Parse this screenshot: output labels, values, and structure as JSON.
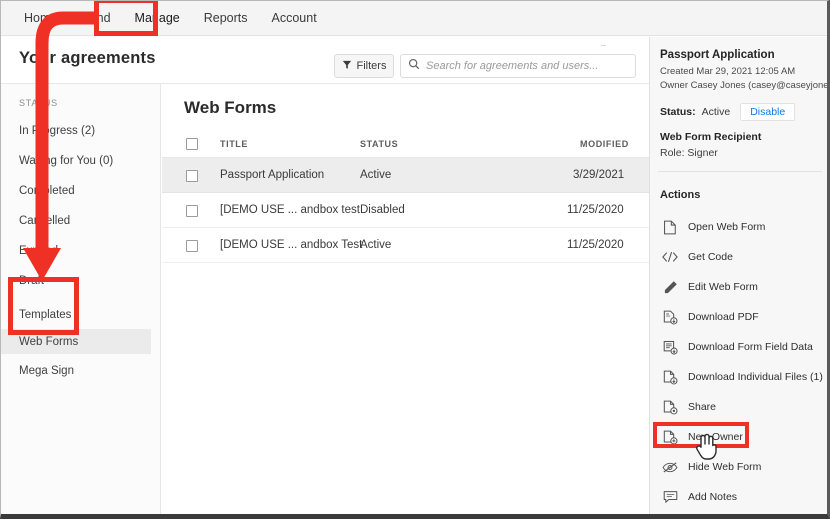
{
  "nav": {
    "tabs": [
      {
        "label": "Home",
        "active": false
      },
      {
        "label": "Send",
        "active": false
      },
      {
        "label": "Manage",
        "active": true
      },
      {
        "label": "Reports",
        "active": false
      },
      {
        "label": "Account",
        "active": false
      }
    ]
  },
  "page": {
    "title": "Your agreements"
  },
  "toolbar": {
    "filters_label": "Filters",
    "filter_icon": "funnel-icon",
    "search_icon": "search-icon",
    "search_placeholder": "Search for agreements and users...",
    "search_value": ""
  },
  "sidebar": {
    "caption": "STATUS",
    "items": [
      {
        "label": "In Progress (2)",
        "selected": false
      },
      {
        "label": "Waiting for You (0)",
        "selected": false
      },
      {
        "label": "Completed",
        "selected": false
      },
      {
        "label": "Cancelled",
        "selected": false
      },
      {
        "label": "Expired",
        "selected": false
      },
      {
        "label": "Draft",
        "selected": false
      },
      {
        "label": "Templates",
        "selected": false
      },
      {
        "label": "Web Forms",
        "selected": true
      },
      {
        "label": "Mega Sign",
        "selected": false
      }
    ]
  },
  "main": {
    "title": "Web Forms",
    "columns": [
      "TITLE",
      "STATUS",
      "MODIFIED"
    ],
    "rows": [
      {
        "title": "Passport Application",
        "status": "Active",
        "modified": "3/29/2021",
        "selected": true
      },
      {
        "title": "[DEMO USE ...  andbox test",
        "status": "Disabled",
        "modified": "11/25/2020",
        "selected": false
      },
      {
        "title": "[DEMO USE ...  andbox Test",
        "status": "Active",
        "modified": "11/25/2020",
        "selected": false
      }
    ]
  },
  "details": {
    "title": "Passport Application",
    "created": "Created Mar 29, 2021 12:05 AM",
    "owner": "Owner Casey Jones (casey@caseyjones.d...)",
    "status_label": "Status:",
    "status_value": "Active",
    "disable_label": "Disable",
    "recipient_heading": "Web Form Recipient",
    "role": "Role: Signer",
    "actions_heading": "Actions",
    "actions": [
      {
        "label": "Open Web Form",
        "icon": "document-icon",
        "highlighted": false
      },
      {
        "label": "Get Code",
        "icon": "code-brackets-icon",
        "highlighted": false
      },
      {
        "label": "Edit Web Form",
        "icon": "pencil-icon",
        "highlighted": false
      },
      {
        "label": "Download PDF",
        "icon": "download-pdf-icon",
        "highlighted": false
      },
      {
        "label": "Download Form Field Data",
        "icon": "download-form-data-icon",
        "highlighted": false
      },
      {
        "label": "Download Individual Files (1)",
        "icon": "download-files-icon",
        "highlighted": false
      },
      {
        "label": "Share",
        "icon": "share-document-icon",
        "highlighted": false
      },
      {
        "label": "New Owner",
        "icon": "new-owner-icon",
        "highlighted": true
      },
      {
        "label": "Hide Web Form",
        "icon": "eye-slash-icon",
        "highlighted": false
      },
      {
        "label": "Add Notes",
        "icon": "speech-bubble-icon",
        "highlighted": false
      }
    ]
  },
  "annotations": {
    "accent_color": "#ee3124",
    "callouts": [
      "manage-tab-highlight",
      "templates-webforms-highlight",
      "new-owner-highlight"
    ],
    "arrow": "manage-to-webforms-arrow"
  }
}
